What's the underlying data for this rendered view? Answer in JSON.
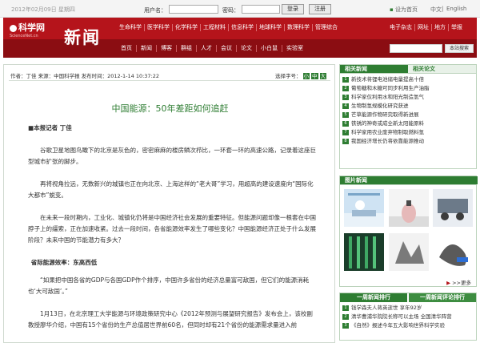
{
  "topbar": {
    "date": "2012年02月09日 星期四",
    "username_label": "用户名：",
    "password_label": "密码：",
    "login_button": "登录",
    "register_button": "注册",
    "homepage_link": "设为首页",
    "lang_cn": "中文",
    "lang_sep": "|",
    "lang_en": "English"
  },
  "header": {
    "logo_text": "科学网",
    "logo_sub": "ScienceNet.cn",
    "section_title": "新闻",
    "nav_primary": [
      "生命科学",
      "医学科学",
      "化学科学",
      "工程材料",
      "信息科学",
      "地球科学",
      "数理科学",
      "管理综合"
    ],
    "nav_right": [
      "电子杂志",
      "网址",
      "地方",
      "举报"
    ],
    "nav_secondary": [
      "首页",
      "新闻",
      "博客",
      "群组",
      "人才",
      "会议",
      "论文",
      "小白鼠",
      "实验室"
    ],
    "search_button": "本站搜索"
  },
  "article": {
    "meta": "作者：丁佳  来源：中国科学报  发布时间：2012-1-14 10:37:22",
    "font_size_label": "选择字号：",
    "font_size_options": [
      "小",
      "中",
      "大"
    ],
    "title": "中国能源：50年差距如何追赶",
    "paragraphs": [
      {
        "kind": "rep",
        "text": "■本报记者  丁佳"
      },
      {
        "kind": "p",
        "text": "谷歌卫星地图鸟瞰下的北京是灰色的，密密麻麻的楼房鳞次栉比，一环套一环的高速公路，记录着这座巨型城市扩张的脚步。"
      },
      {
        "kind": "p",
        "text": "再将视角拉远，无数新兴的城镇也正在向北京、上海这样的“老大哥”学习，用超高的建设速度向“国际化大都市”蜕变。"
      },
      {
        "kind": "p",
        "text": "在未来一段时期内，工业化、城镇化仍将是中国经济社会发展的重要特征。但能源问题却像一根套在中国脖子上的缰索，正在加速收紧。过去一段时间，各省能源效率发生了哪些变化？中国能源经济正处于什么发展阶段？未来中国的节能潜力有多大？"
      },
      {
        "kind": "sub",
        "text": "省际能源效率：东高西低"
      },
      {
        "kind": "p",
        "text": "“如果把中国各省的GDP与各国GDP作个排序，中国许多省份的经济总量富可敌国，但它们的能源消耗也‘大可敌国’。”"
      },
      {
        "kind": "p",
        "text": "1月13日，在北京理工大学能源与环境政策研究中心《2012年预测与展望研究报告》发布会上，该校副教授廖华介绍，中国有15个省份的生产总值居世界前60名，但同时却有21个省份的能源需求量进入前"
      }
    ]
  },
  "sidebar": {
    "tab_related_news": "相关新闻",
    "tab_related_papers": "相关论文",
    "related_news": [
      "新技术将锂电池储电量提高十倍",
      "葡萄糖和木糖可同步利用生产油脂",
      "科学家仅利用水和阳光制造氢气",
      "生物制氢规模化研究获进",
      "芒草能源作物研究取得新进展",
      "铁锈的神奇或成全新太阳能原料",
      "科学家用农业废弃物制取燃料氢",
      "我国经济增长仍将依靠能源推动"
    ],
    "pictures_title": "图片新闻",
    "more_label": ">>更多",
    "rank_week": "一周新闻排行",
    "rank_comment": "一周新闻评论排行",
    "rank_list": [
      "钱学森夫人蒋英逝世 享年92岁",
      "清华曹浦华院院长称可以主场 全国清华阵营",
      "《自然》报述今年五大影响世界科学实验"
    ]
  }
}
